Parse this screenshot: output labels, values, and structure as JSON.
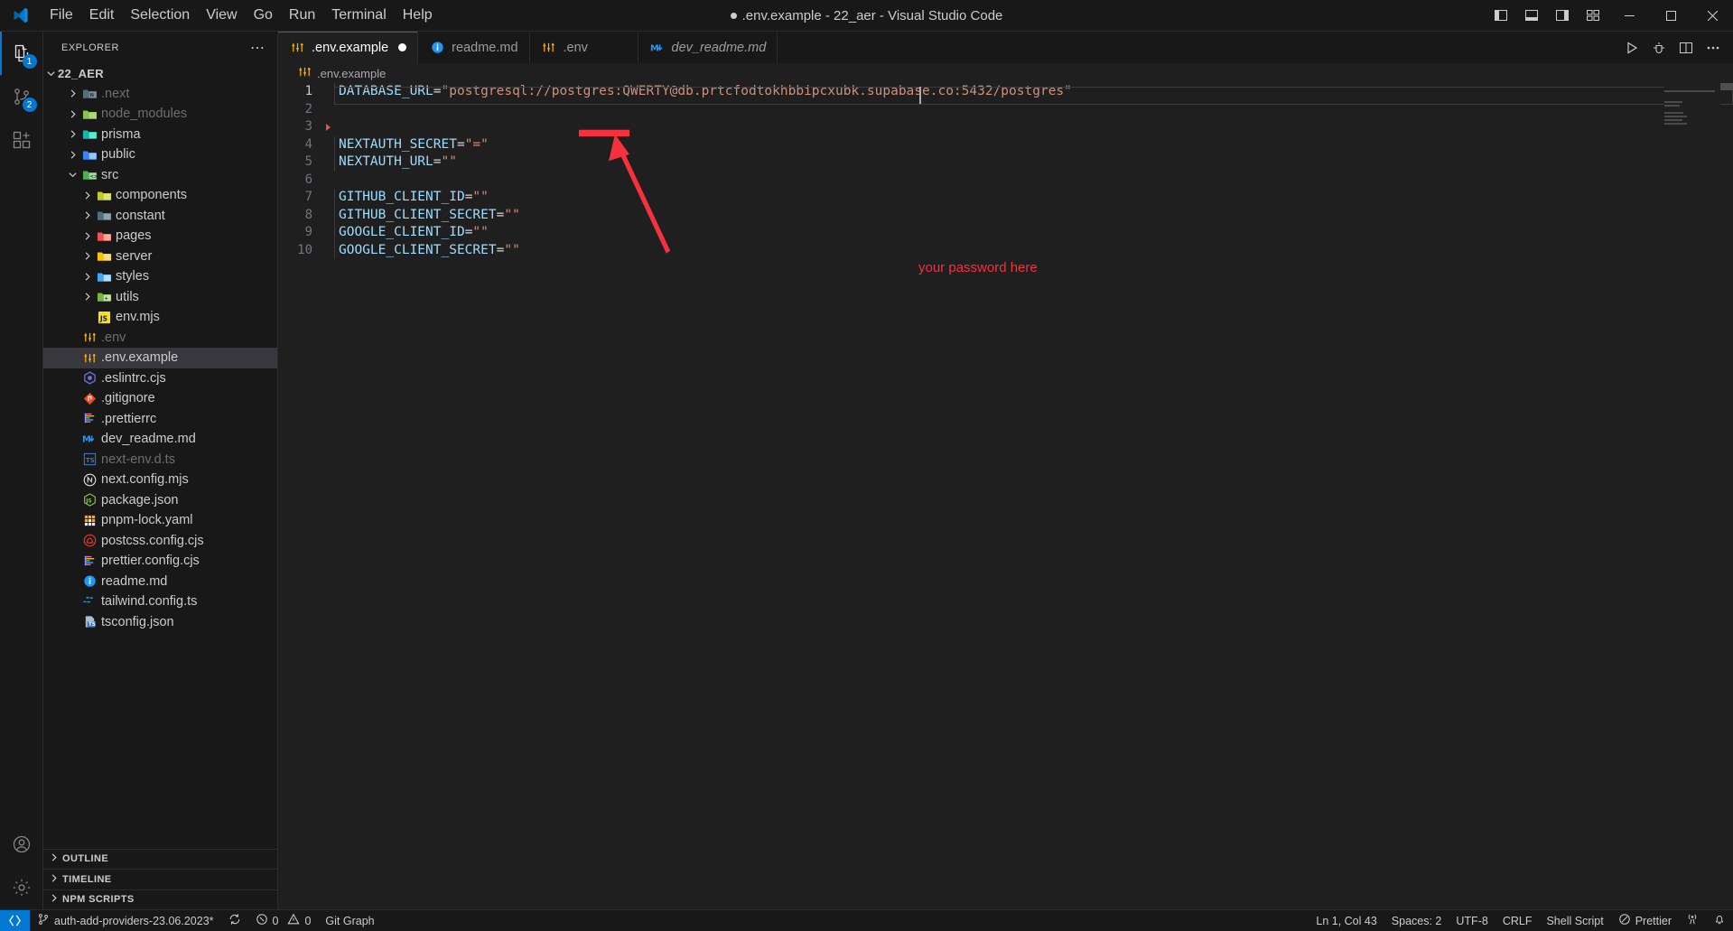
{
  "window": {
    "title": ".env.example - 22_aer - Visual Studio Code",
    "dirty": true,
    "minimize_label": "—",
    "maximize_label": "❐",
    "close_label": "✕"
  },
  "menubar": {
    "items": [
      {
        "label": "File"
      },
      {
        "label": "Edit"
      },
      {
        "label": "Selection"
      },
      {
        "label": "View"
      },
      {
        "label": "Go"
      },
      {
        "label": "Run"
      },
      {
        "label": "Terminal"
      },
      {
        "label": "Help"
      }
    ]
  },
  "activitybar": {
    "items": [
      {
        "name": "explorer",
        "icon": "files-icon",
        "active": true,
        "badge": "1"
      },
      {
        "name": "source-control",
        "icon": "source-control-icon",
        "active": false,
        "badge": "2"
      },
      {
        "name": "extensions",
        "icon": "extensions-icon",
        "active": false,
        "badge": ""
      }
    ],
    "bottom": [
      {
        "name": "accounts",
        "icon": "account-icon"
      },
      {
        "name": "manage",
        "icon": "gear-icon"
      }
    ]
  },
  "sidebar": {
    "title": "EXPLORER",
    "more_actions": "⋯",
    "root": {
      "label": "22_AER",
      "expanded": true
    },
    "tree": [
      {
        "label": ".next",
        "type": "folder",
        "indent": 1,
        "expanded": false,
        "icon": "folder-next",
        "color": "#6e7681",
        "dim": true
      },
      {
        "label": "node_modules",
        "type": "folder",
        "indent": 1,
        "expanded": false,
        "icon": "folder-node",
        "color": "#8dc149",
        "dim": true
      },
      {
        "label": "prisma",
        "type": "folder",
        "indent": 1,
        "expanded": false,
        "icon": "folder-prisma",
        "color": "#14b8a6",
        "dim": false
      },
      {
        "label": "public",
        "type": "folder",
        "indent": 1,
        "expanded": false,
        "icon": "folder-public",
        "color": "#3b82f6",
        "dim": false
      },
      {
        "label": "src",
        "type": "folder",
        "indent": 1,
        "expanded": true,
        "icon": "folder-src",
        "color": "#4caf50",
        "dim": false
      },
      {
        "label": "components",
        "type": "folder",
        "indent": 2,
        "expanded": false,
        "icon": "folder-components",
        "color": "#c0ca33",
        "dim": false
      },
      {
        "label": "constant",
        "type": "folder",
        "indent": 2,
        "expanded": false,
        "icon": "folder-constant",
        "color": "#546e7a",
        "dim": false
      },
      {
        "label": "pages",
        "type": "folder",
        "indent": 2,
        "expanded": false,
        "icon": "folder-pages",
        "color": "#ef5350",
        "dim": false
      },
      {
        "label": "server",
        "type": "folder",
        "indent": 2,
        "expanded": false,
        "icon": "folder-server",
        "color": "#ffc107",
        "dim": false
      },
      {
        "label": "styles",
        "type": "folder",
        "indent": 2,
        "expanded": false,
        "icon": "folder-styles",
        "color": "#42a5f5",
        "dim": false
      },
      {
        "label": "utils",
        "type": "folder",
        "indent": 2,
        "expanded": false,
        "icon": "folder-utils",
        "color": "#7cb342",
        "dim": false
      },
      {
        "label": "env.mjs",
        "type": "file",
        "indent": 2,
        "icon": "js-icon",
        "color": "#f7df1e",
        "dim": false
      },
      {
        "label": ".env",
        "type": "file",
        "indent": 1,
        "icon": "tune-icon",
        "color": "#ffb300",
        "dim": true
      },
      {
        "label": ".env.example",
        "type": "file",
        "indent": 1,
        "icon": "tune-icon",
        "color": "#ffb300",
        "dim": false,
        "selected": true
      },
      {
        "label": ".eslintrc.cjs",
        "type": "file",
        "indent": 1,
        "icon": "eslint-icon",
        "color": "#6f6fd6",
        "dim": false
      },
      {
        "label": ".gitignore",
        "type": "file",
        "indent": 1,
        "icon": "git-icon",
        "color": "#e8502a",
        "dim": false
      },
      {
        "label": ".prettierrc",
        "type": "file",
        "indent": 1,
        "icon": "prettier-icon",
        "color": "#56b3b4",
        "dim": false
      },
      {
        "label": "dev_readme.md",
        "type": "file",
        "indent": 1,
        "icon": "markdown-icon",
        "color": "#2196f3",
        "dim": false
      },
      {
        "label": "next-env.d.ts",
        "type": "file",
        "indent": 1,
        "icon": "ts-icon",
        "color": "#3178c6",
        "dim": true
      },
      {
        "label": "next.config.mjs",
        "type": "file",
        "indent": 1,
        "icon": "nextjs-icon",
        "color": "#e0e0e0",
        "dim": false
      },
      {
        "label": "package.json",
        "type": "file",
        "indent": 1,
        "icon": "npm-icon",
        "color": "#8bc34a",
        "dim": false
      },
      {
        "label": "pnpm-lock.yaml",
        "type": "file",
        "indent": 1,
        "icon": "yaml-icon",
        "color": "#f9a825",
        "dim": false
      },
      {
        "label": "postcss.config.cjs",
        "type": "file",
        "indent": 1,
        "icon": "postcss-icon",
        "color": "#e53935",
        "dim": false
      },
      {
        "label": "prettier.config.cjs",
        "type": "file",
        "indent": 1,
        "icon": "prettier-icon",
        "color": "#56b3b4",
        "dim": false
      },
      {
        "label": "readme.md",
        "type": "file",
        "indent": 1,
        "icon": "info-icon",
        "color": "#2196f3",
        "dim": false
      },
      {
        "label": "tailwind.config.ts",
        "type": "file",
        "indent": 1,
        "icon": "tailwind-icon",
        "color": "#38bdf8",
        "dim": false
      },
      {
        "label": "tsconfig.json",
        "type": "file",
        "indent": 1,
        "icon": "tsconfig-icon",
        "color": "#3178c6",
        "dim": false
      }
    ],
    "sections": [
      {
        "label": "OUTLINE"
      },
      {
        "label": "TIMELINE"
      },
      {
        "label": "NPM SCRIPTS"
      }
    ]
  },
  "tabs": [
    {
      "label": ".env.example",
      "icon": "tune-icon",
      "icon_color": "#ffb300",
      "active": true,
      "dirty": true,
      "italic": false
    },
    {
      "label": "readme.md",
      "icon": "info-icon",
      "icon_color": "#2196f3",
      "active": false,
      "dirty": false,
      "italic": false
    },
    {
      "label": ".env",
      "icon": "tune-icon",
      "icon_color": "#ffb300",
      "active": false,
      "dirty": false,
      "italic": false
    },
    {
      "label": "dev_readme.md",
      "icon": "markdown-icon",
      "icon_color": "#2196f3",
      "active": false,
      "dirty": false,
      "italic": true
    }
  ],
  "editor_actions": [
    {
      "name": "run-button",
      "icon": "play-icon"
    },
    {
      "name": "run-and-debug-button",
      "icon": "debug-alt-icon"
    },
    {
      "name": "split-editor-button",
      "icon": "split-editor-icon"
    },
    {
      "name": "more-actions-button",
      "icon": "ellipsis-icon"
    }
  ],
  "breadcrumbs": {
    "icon": "tune-icon",
    "path": ".env.example"
  },
  "editor": {
    "language_syntax": "Shell Script",
    "lines": [
      {
        "n": "1",
        "key": "DATABASE_URL",
        "op": "=",
        "str": "\"postgresql://postgres:QWERTY@db.prtcfodtokhbbipcxubk.supabase.co:5432/postgres\"",
        "indent_guide": true,
        "current": true
      },
      {
        "n": "2",
        "key": "",
        "op": "",
        "str": "",
        "indent_guide": false,
        "current": false
      },
      {
        "n": "3",
        "key": "",
        "op": "",
        "str": "",
        "indent_guide": false,
        "current": false,
        "fold_marker": true
      },
      {
        "n": "4",
        "key": "NEXTAUTH_SECRET",
        "op": "=",
        "str": "\"=\"",
        "indent_guide": true,
        "current": false
      },
      {
        "n": "5",
        "key": "NEXTAUTH_URL",
        "op": "=",
        "str": "\"\"",
        "indent_guide": true,
        "current": false
      },
      {
        "n": "6",
        "key": "",
        "op": "",
        "str": "",
        "indent_guide": false,
        "current": false
      },
      {
        "n": "7",
        "key": "GITHUB_CLIENT_ID",
        "op": "=",
        "str": "\"\"",
        "indent_guide": true,
        "current": false
      },
      {
        "n": "8",
        "key": "GITHUB_CLIENT_SECRET",
        "op": "=",
        "str": "\"\"",
        "indent_guide": true,
        "current": false
      },
      {
        "n": "9",
        "key": "GOOGLE_CLIENT_ID",
        "op": "=",
        "str": "\"\"",
        "indent_guide": true,
        "current": false
      },
      {
        "n": "10",
        "key": "GOOGLE_CLIENT_SECRET",
        "op": "=",
        "str": "\"\"",
        "indent_guide": true,
        "current": false
      }
    ]
  },
  "annotation": {
    "text": "your password here",
    "color": "#f4313c"
  },
  "statusbar": {
    "remote_icon": "remote-indicator-icon",
    "branch_icon": "source-control-icon",
    "branch": "auth-add-providers-23.06.2023*",
    "sync_icon": "sync-icon",
    "errors_icon": "error-icon",
    "errors": "0",
    "warnings_icon": "warning-icon",
    "warnings": "0",
    "git_graph": "Git Graph",
    "cursor_position": "Ln 1, Col 43",
    "indentation": "Spaces: 2",
    "encoding": "UTF-8",
    "eol": "CRLF",
    "language_mode": "Shell Script",
    "prettier_icon": "check-circle-icon",
    "prettier": "Prettier",
    "radio_icon": "radio-tower-icon",
    "bell_icon": "bell-dot-icon"
  }
}
